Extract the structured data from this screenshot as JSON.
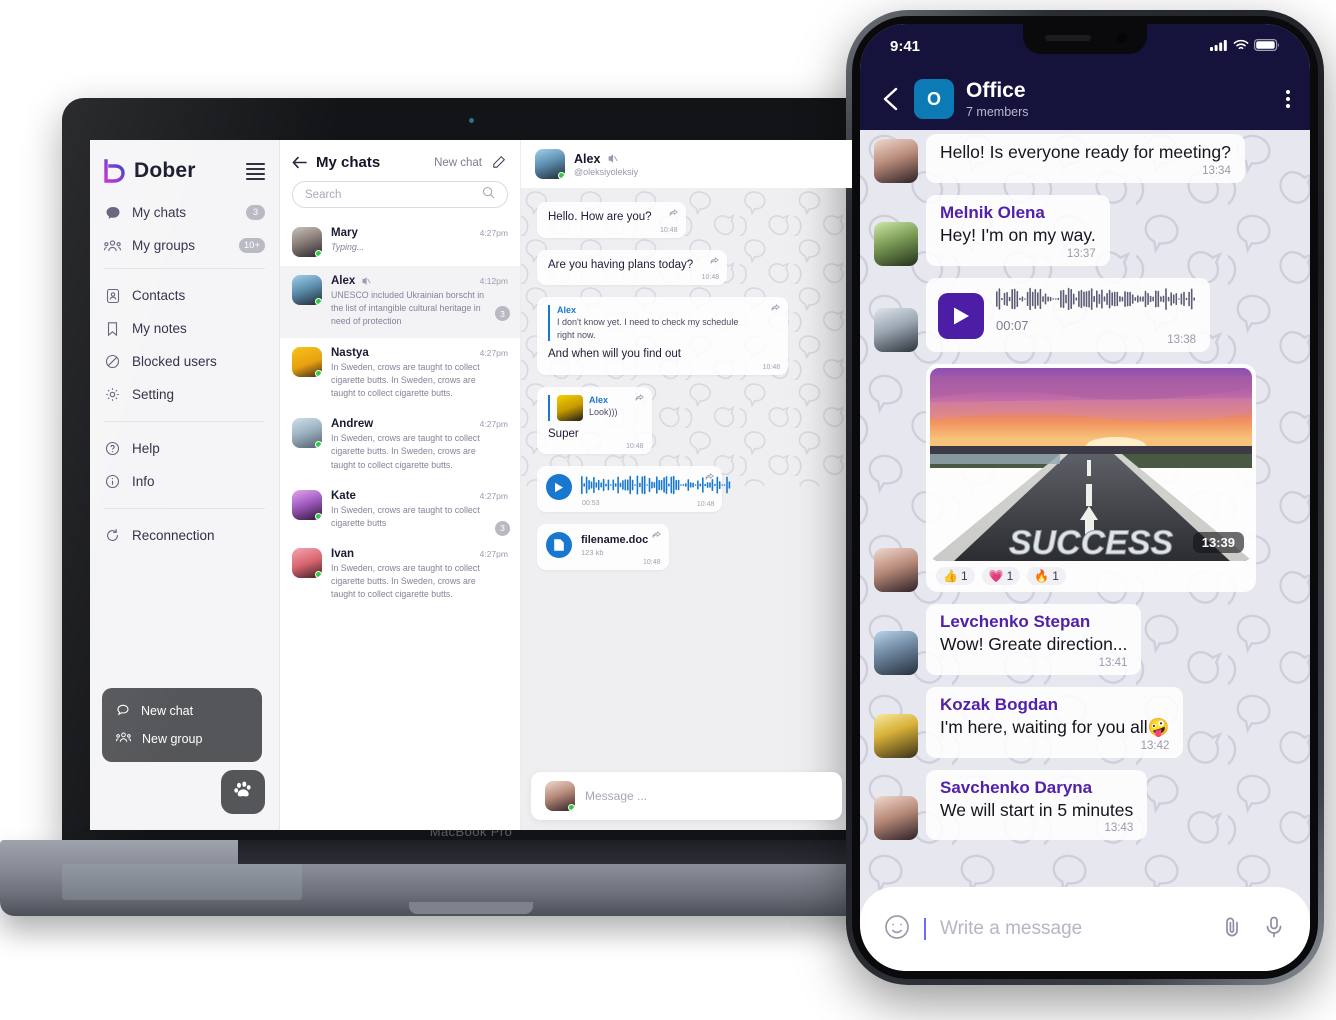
{
  "desktop": {
    "brand": {
      "name": "Dober"
    },
    "sidebar": {
      "primary": [
        {
          "label": "My chats",
          "icon": "chat-icon",
          "badge": "3"
        },
        {
          "label": "My groups",
          "icon": "group-icon",
          "badge": "10+"
        }
      ],
      "secondary": [
        {
          "label": "Contacts",
          "icon": "contacts-icon"
        },
        {
          "label": "My notes",
          "icon": "bookmark-icon"
        },
        {
          "label": "Blocked users",
          "icon": "blocked-icon"
        },
        {
          "label": "Setting",
          "icon": "gear-icon"
        }
      ],
      "tertiary": [
        {
          "label": "Help",
          "icon": "help-icon"
        },
        {
          "label": "Info",
          "icon": "info-icon"
        }
      ],
      "quaternary": [
        {
          "label": "Reconnection",
          "icon": "refresh-icon"
        }
      ],
      "fab_menu": [
        {
          "label": "New chat",
          "icon": "new-chat-icon"
        },
        {
          "label": "New group",
          "icon": "new-group-icon"
        }
      ],
      "fab_icon": "paw-icon"
    },
    "chat_list": {
      "title": "My chats",
      "new_chat_label": "New chat",
      "search_placeholder": "Search",
      "items": [
        {
          "name": "Mary",
          "time": "4:27pm",
          "message": "Typing...",
          "typing": true,
          "muted": false,
          "unread": "",
          "avatar": "a1"
        },
        {
          "name": "Alex",
          "time": "4:12pm",
          "message": "UNESCO included Ukrainian borscht in the list of intangible cultural heritage in need of protection",
          "typing": false,
          "muted": true,
          "unread": "3",
          "avatar": "a2",
          "active": true
        },
        {
          "name": "Nastya",
          "time": "4:27pm",
          "message": "In Sweden, crows are taught to collect cigarette butts. In Sweden, crows are taught to collect cigarette butts.",
          "typing": false,
          "muted": false,
          "unread": "",
          "avatar": "a3"
        },
        {
          "name": "Andrew",
          "time": "4:27pm",
          "message": "In Sweden, crows are taught to collect cigarette butts. In Sweden, crows are taught to collect cigarette butts.",
          "typing": false,
          "muted": false,
          "unread": "",
          "avatar": "a4"
        },
        {
          "name": "Kate",
          "time": "4:27pm",
          "message": "In Sweden, crows are taught to collect cigarette butts",
          "typing": false,
          "muted": false,
          "unread": "3",
          "avatar": "a5"
        },
        {
          "name": "Ivan",
          "time": "4:27pm",
          "message": "In Sweden, crows are taught to collect cigarette butts. In Sweden, crows are taught to collect cigarette butts.",
          "typing": false,
          "muted": false,
          "unread": "",
          "avatar": "a6"
        }
      ]
    },
    "conversation": {
      "header": {
        "name": "Alex",
        "handle": "@oleksiyoleksiy",
        "muted": true,
        "avatar": "a2"
      },
      "messages": [
        {
          "type": "text",
          "text": "Hello. How are you?",
          "time": "10:48"
        },
        {
          "type": "text",
          "text": "Are you having plans today?",
          "time": "10:48"
        },
        {
          "type": "quote-text",
          "quote_name": "Alex",
          "quote_text": "I don't know yet. I need to check my schedule right now.",
          "text": "And when will you find out",
          "time": "10:48"
        },
        {
          "type": "quote-image-text",
          "quote_name": "Alex",
          "quote_text": "Look)))",
          "text": "Super",
          "time": "10:48"
        },
        {
          "type": "voice",
          "duration": "00:53",
          "time": "10:48"
        },
        {
          "type": "file",
          "filename": "filename.doc",
          "filesize": "123 kb",
          "time": "10:48"
        }
      ],
      "composer_placeholder": "Message ..."
    },
    "device_label": "MacBook Pro"
  },
  "phone": {
    "status": {
      "time": "9:41"
    },
    "header": {
      "group_initial": "O",
      "title": "Office",
      "subtitle": "7 members"
    },
    "messages": [
      {
        "type": "text",
        "avatar": "a7",
        "name": "",
        "text": "Hello! Is everyone ready for meeting?",
        "time": "13:34"
      },
      {
        "type": "text",
        "avatar": "a9",
        "name": "Melnik Olena",
        "text": "Hey! I'm on my way.",
        "time": "13:37"
      },
      {
        "type": "voice",
        "avatar": "a10",
        "duration": "00:07",
        "time": "13:38"
      },
      {
        "type": "image",
        "avatar": "a7",
        "time": "13:39",
        "caption": "SUCCESS",
        "reactions": [
          {
            "emoji": "👍",
            "count": "1"
          },
          {
            "emoji": "💗",
            "count": "1"
          },
          {
            "emoji": "🔥",
            "count": "1"
          }
        ]
      },
      {
        "type": "text",
        "avatar": "a11",
        "name": "Levchenko Stepan",
        "text": "Wow! Greate direction...",
        "time": "13:41"
      },
      {
        "type": "text",
        "avatar": "a12",
        "name": "Kozak Bogdan",
        "text": "I'm here, waiting for you all🤪",
        "time": "13:42"
      },
      {
        "type": "text",
        "avatar": "a7",
        "name": "Savchenko Daryna",
        "text": "We will start in 5 minutes",
        "time": "13:43"
      }
    ],
    "composer": {
      "placeholder": "Write a message",
      "emoji_icon": "smiley-icon",
      "attach_icon": "paperclip-icon",
      "mic_icon": "microphone-icon"
    }
  },
  "colors": {
    "brand_purple": "#4b1ea5",
    "accent_blue": "#1878d0",
    "header_navy": "#15123b",
    "group_avatar": "#0b7ab5",
    "sender_name": "#5321a8",
    "online_green": "#2ecc40"
  }
}
